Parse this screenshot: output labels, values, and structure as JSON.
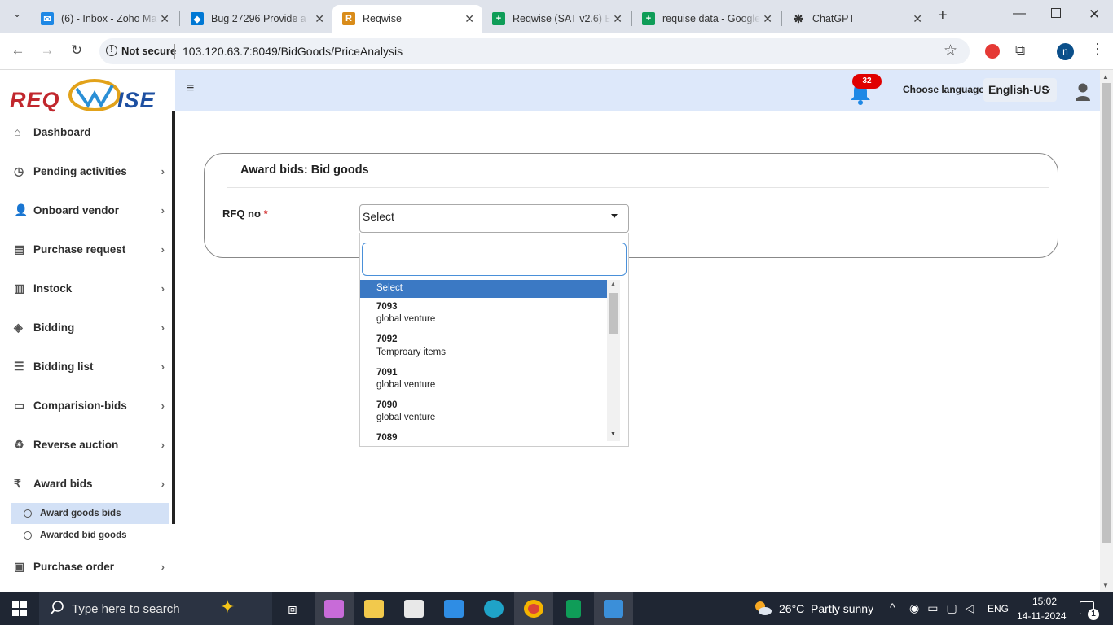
{
  "browser": {
    "tabs": [
      {
        "title": "(6) - Inbox - Zoho Ma",
        "icon": "zoho-mail-icon",
        "color": "#1e88e5"
      },
      {
        "title": "Bug 27296 Provide a",
        "icon": "azure-devops-icon",
        "color": "#0078d4"
      },
      {
        "title": "Reqwise",
        "icon": "reqwise-icon",
        "color": "#d98c1a"
      },
      {
        "title": "Reqwise (SAT v2.6) Er",
        "icon": "google-sheets-icon",
        "color": "#0f9d58"
      },
      {
        "title": "requise data - Google",
        "icon": "google-sheets-icon",
        "color": "#0f9d58"
      },
      {
        "title": "ChatGPT",
        "icon": "chatgpt-icon",
        "color": "#333333"
      }
    ],
    "not_secure": "Not secure",
    "url": "103.120.63.7:8049/BidGoods/PriceAnalysis",
    "profile_initial": "n"
  },
  "app": {
    "logo_text": "REQWISE",
    "notifications_count": "32",
    "choose_language_label": "Choose language",
    "language": "English-US"
  },
  "sidebar": {
    "items": [
      {
        "label": "Dashboard",
        "icon": "home-icon",
        "chevron": false
      },
      {
        "label": "Pending activities",
        "icon": "clock-icon",
        "chevron": true
      },
      {
        "label": "Onboard vendor",
        "icon": "user-plus-icon",
        "chevron": true
      },
      {
        "label": "Purchase request",
        "icon": "clipboard-icon",
        "chevron": true
      },
      {
        "label": "Instock",
        "icon": "bar-chart-icon",
        "chevron": true
      },
      {
        "label": "Bidding",
        "icon": "gavel-icon",
        "chevron": true
      },
      {
        "label": "Bidding list",
        "icon": "list-icon",
        "chevron": true
      },
      {
        "label": "Comparision-bids",
        "icon": "compare-icon",
        "chevron": true
      },
      {
        "label": "Reverse auction",
        "icon": "recycle-icon",
        "chevron": true
      },
      {
        "label": "Award bids",
        "icon": "rupee-icon",
        "chevron": true
      }
    ],
    "sub_items": [
      {
        "label": "Award goods bids",
        "selected": true
      },
      {
        "label": "Awarded bid goods",
        "selected": false
      }
    ],
    "last_item": {
      "label": "Purchase order",
      "icon": "cart-icon",
      "chevron": true
    }
  },
  "main": {
    "card_title": "Award bids: Bid goods",
    "rfq_label": "RFQ no",
    "required_mark": "*",
    "select_value": "Select",
    "search_value": "",
    "options": [
      {
        "label": "Select"
      },
      {
        "number": "7093",
        "name": "global venture"
      },
      {
        "number": "7092",
        "name": "Temproary items"
      },
      {
        "number": "7091",
        "name": "global venture"
      },
      {
        "number": "7090",
        "name": "global venture"
      },
      {
        "number": "7089",
        "name": ""
      }
    ]
  },
  "taskbar": {
    "search_placeholder": "Type here to search",
    "weather": "26°C  Partly sunny",
    "lang": "ENG",
    "time": "15:02",
    "date": "14-11-2024",
    "notif_count": "1"
  }
}
